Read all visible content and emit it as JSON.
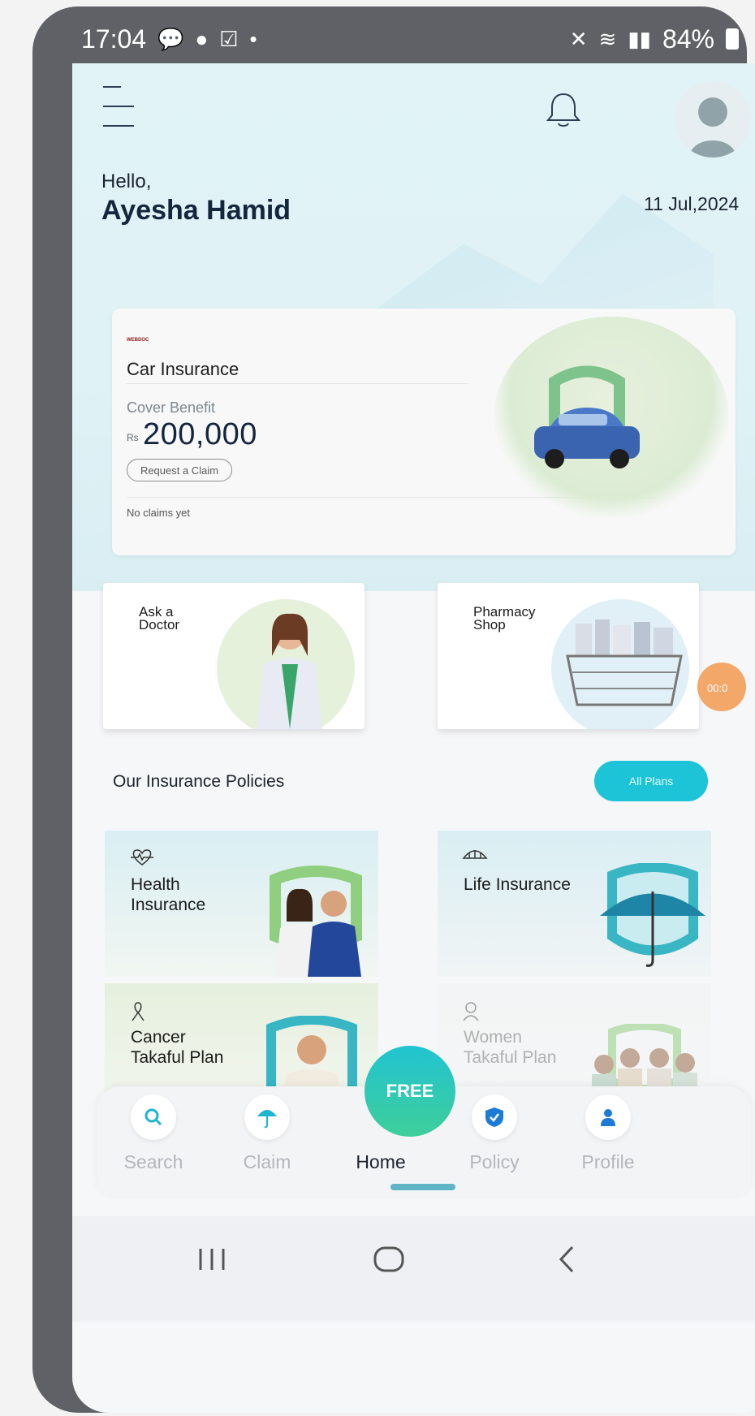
{
  "status_bar": {
    "time": "17:04",
    "battery": "84%"
  },
  "header": {
    "greeting": "Hello,",
    "user_name": "Ayesha Hamid",
    "date": "11 Jul,2024"
  },
  "insurance_card": {
    "brand": "WEBDOC",
    "title": "Car Insurance",
    "cover_label": "Cover Benefit",
    "currency": "Rs",
    "amount": "200,000",
    "claim_button": "Request a Claim",
    "claims_status": "No claims yet"
  },
  "services": [
    {
      "label": "Ask a\nDoctor"
    },
    {
      "label": "Pharmacy\nShop"
    }
  ],
  "timer_badge": "00:0",
  "policies_section": {
    "title": "Our Insurance Policies",
    "all_plans_button": "All Plans",
    "items": [
      {
        "label": "Health\nInsurance",
        "icon": "heartbeat-icon"
      },
      {
        "label": "Life Insurance",
        "icon": "umbrella-icon"
      },
      {
        "label": "Cancer\nTakaful Plan",
        "icon": "ribbon-icon"
      },
      {
        "label": "Women\nTakaful Plan",
        "icon": "woman-icon"
      }
    ]
  },
  "bottom_nav": {
    "items": [
      {
        "label": "Search",
        "icon": "search-icon"
      },
      {
        "label": "Claim",
        "icon": "umbrella-icon"
      },
      {
        "label": "Home",
        "icon": "fikr-free-logo"
      },
      {
        "label": "Policy",
        "icon": "shield-icon"
      },
      {
        "label": "Profile",
        "icon": "person-icon"
      }
    ],
    "home_logo_text": "FREE"
  },
  "colors": {
    "accent": "#1dc3d6",
    "title_dark": "#13263d",
    "timer": "#f3a768"
  }
}
